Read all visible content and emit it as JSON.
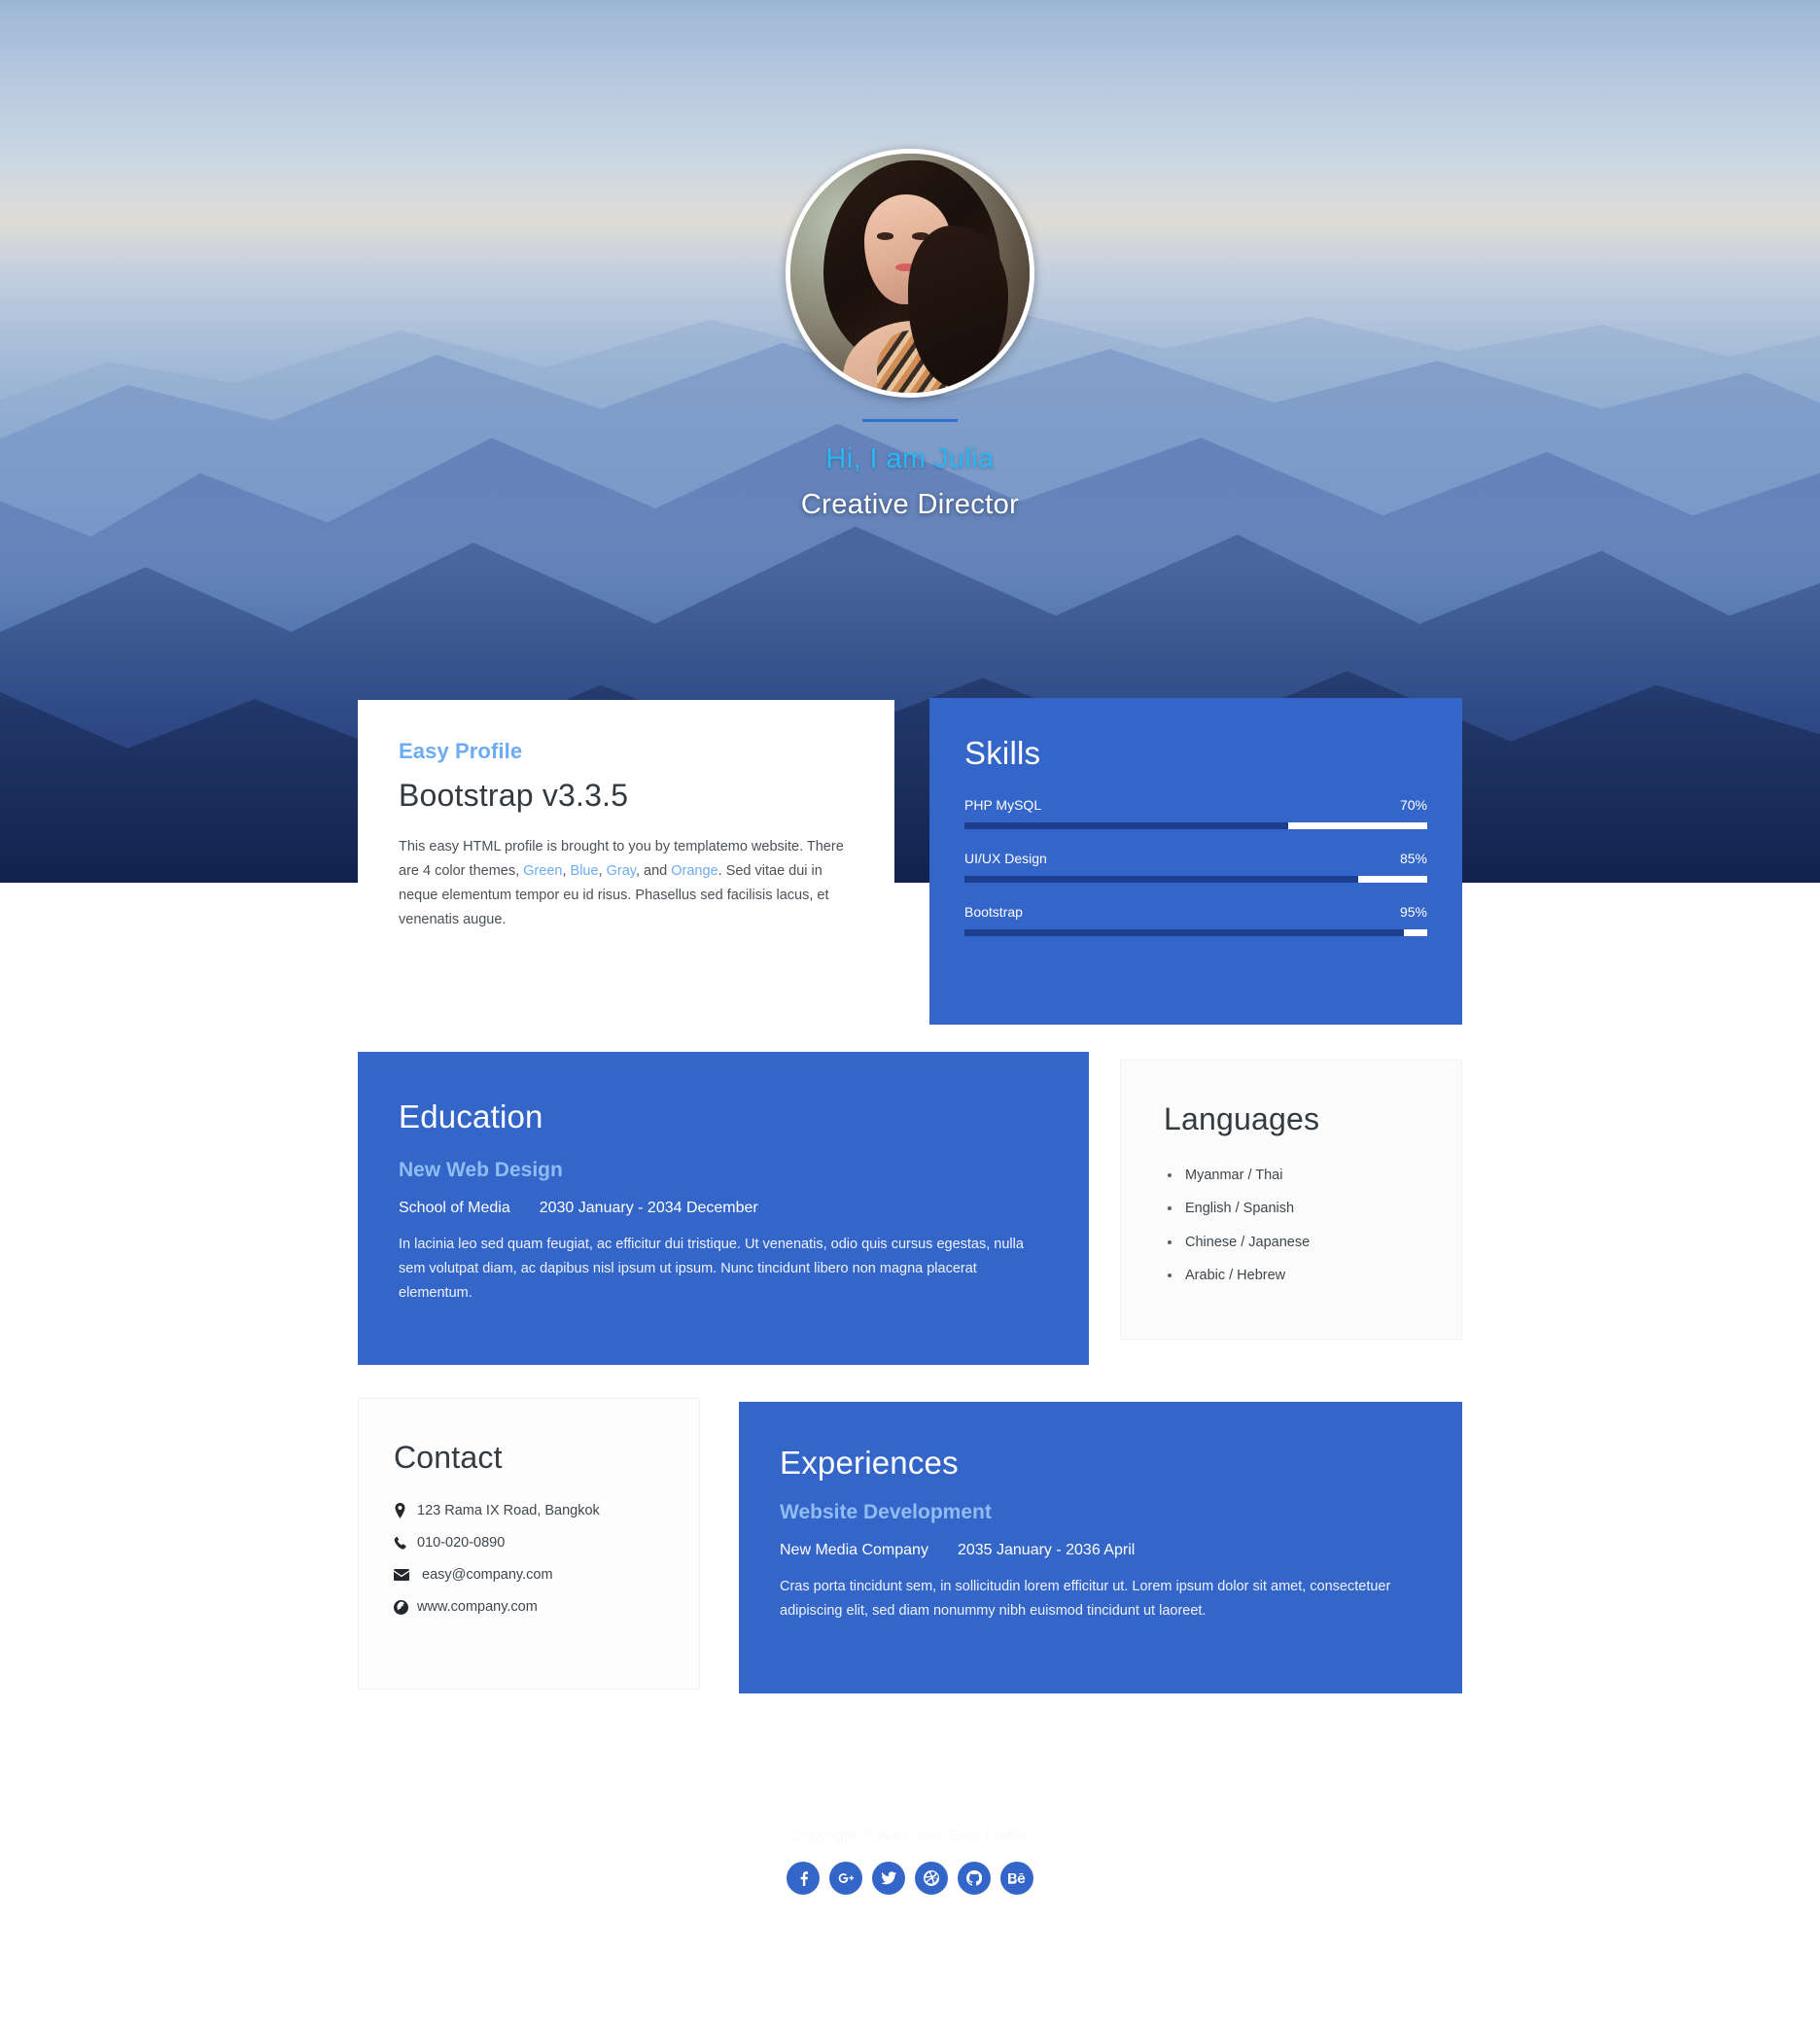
{
  "hero": {
    "avatar_name": "profile-photo",
    "greeting": "Hi, I am Julia",
    "role": "Creative Director",
    "name_color": "#2ab5f5",
    "divider_color": "#2f6fd0"
  },
  "profile_card": {
    "kicker": "Easy Profile",
    "title": "Bootstrap v3.3.5",
    "body_part1": "This easy HTML profile is brought to you by templatemo website. There are 4 color themes, ",
    "theme_links": [
      "Green",
      "Blue",
      "Gray",
      "Orange"
    ],
    "body_part2": ". Sed vitae dui in neque elementum tempor eu id risus. Phasellus sed facilisis lacus, et venenatis augue.",
    "link_color": "#6cacf0"
  },
  "skills_card": {
    "title": "Skills",
    "items": [
      {
        "label": "PHP MySQL",
        "percent": "70%",
        "value": 70
      },
      {
        "label": "UI/UX Design",
        "percent": "85%",
        "value": 85
      },
      {
        "label": "Bootstrap",
        "percent": "95%",
        "value": 95
      }
    ]
  },
  "education_card": {
    "title": "Education",
    "program": "New Web Design",
    "institution": "School of Media",
    "dates": "2030 January - 2034 December",
    "description": "In lacinia leo sed quam feugiat, ac efficitur dui tristique. Ut venenatis, odio quis cursus egestas, nulla sem volutpat diam, ac dapibus nisl ipsum ut ipsum. Nunc tincidunt libero non magna placerat elementum."
  },
  "languages_card": {
    "title": "Languages",
    "items": [
      "Myanmar / Thai",
      "English / Spanish",
      "Chinese / Japanese",
      "Arabic / Hebrew"
    ]
  },
  "contact_card": {
    "title": "Contact",
    "items": [
      {
        "icon": "map-marker-icon",
        "text": "123 Rama IX Road, Bangkok"
      },
      {
        "icon": "phone-icon",
        "text": "010-020-0890"
      },
      {
        "icon": "envelope-icon",
        "text": "easy@company.com"
      },
      {
        "icon": "globe-icon",
        "text": "www.company.com"
      }
    ]
  },
  "experiences_card": {
    "title": "Experiences",
    "role": "Website Development",
    "company": "New Media Company",
    "dates": "2035 January - 2036 April",
    "description": "Cras porta tincidunt sem, in sollicitudin lorem efficitur ut. Lorem ipsum dolor sit amet, consectetuer adipiscing elit, sed diam nonummy nibh euismod tincidunt ut laoreet."
  },
  "footer": {
    "copyright": "Copyright © 2084 Your Easy Profile",
    "socials": [
      {
        "icon": "facebook-icon",
        "label": "Facebook"
      },
      {
        "icon": "google-plus-icon",
        "label": "Google Plus"
      },
      {
        "icon": "twitter-icon",
        "label": "Twitter"
      },
      {
        "icon": "dribbble-icon",
        "label": "Dribbble"
      },
      {
        "icon": "github-icon",
        "label": "GitHub"
      },
      {
        "icon": "behance-icon",
        "label": "Behance"
      }
    ],
    "accent_color": "#3465c8"
  }
}
